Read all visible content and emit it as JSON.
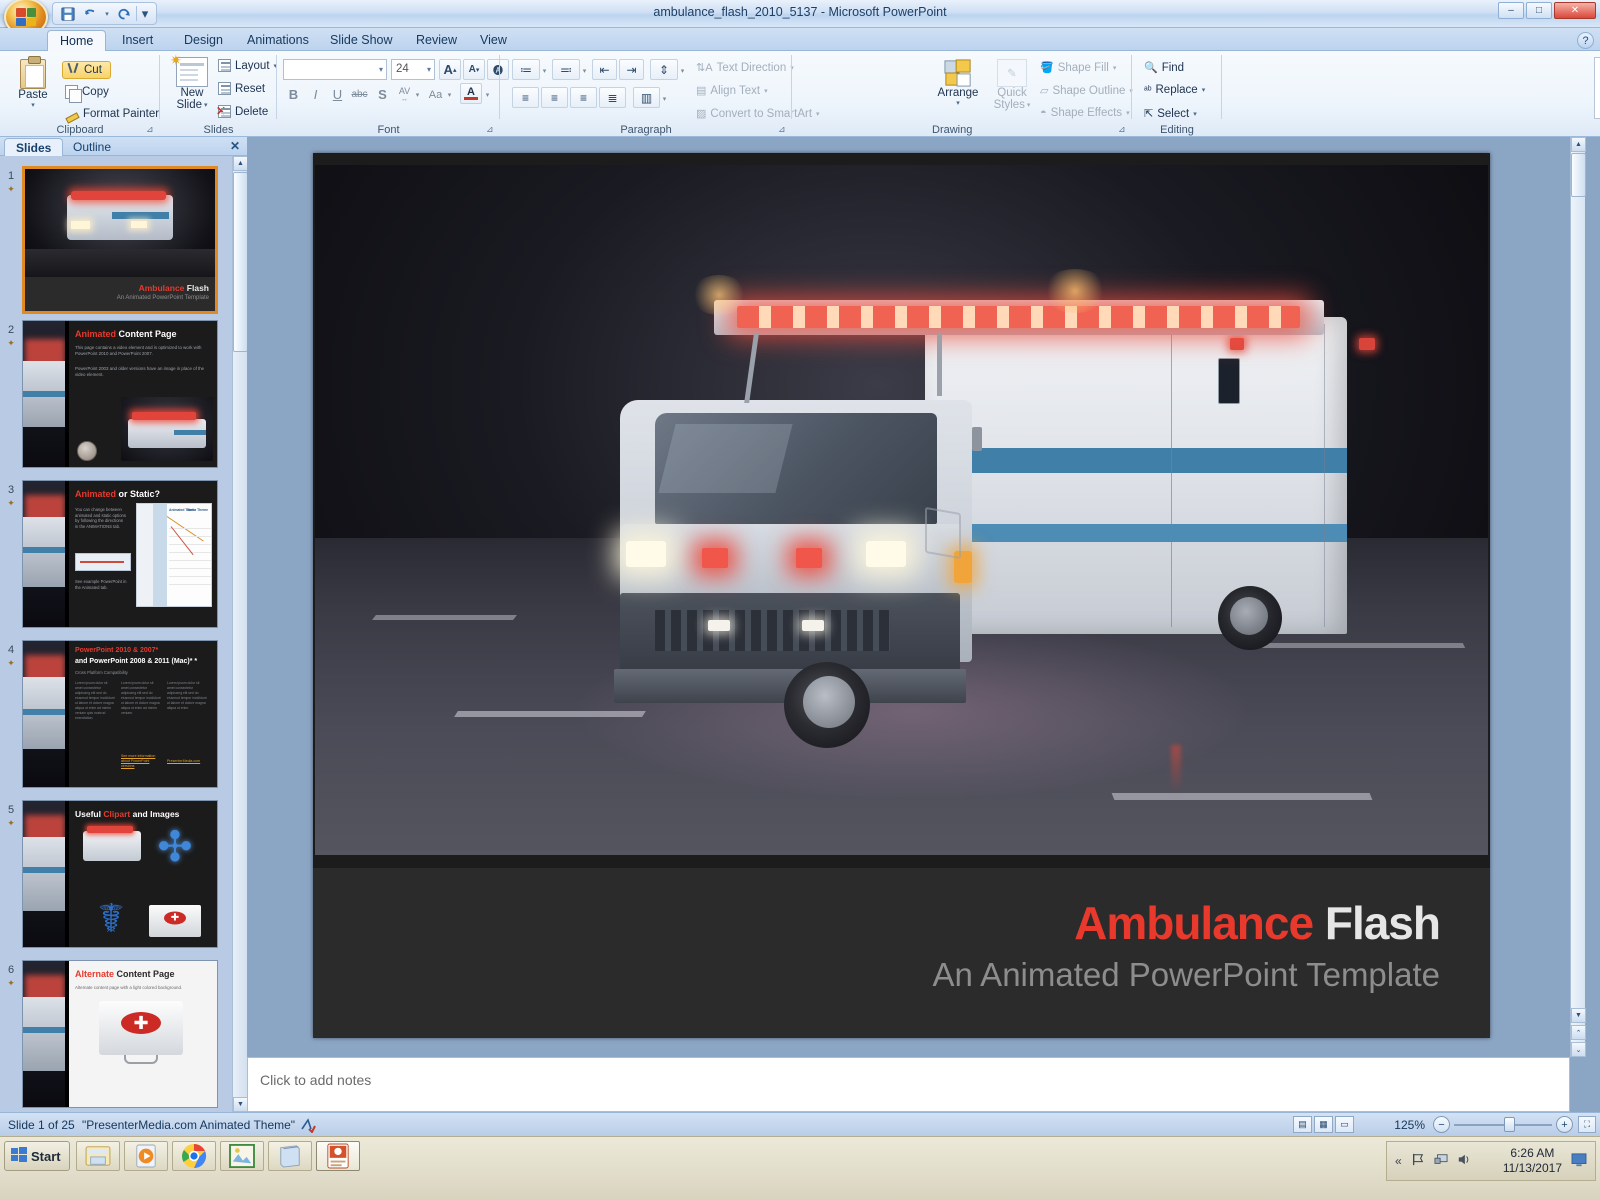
{
  "window": {
    "title": "ambulance_flash_2010_5137 - Microsoft PowerPoint",
    "minimize": "–",
    "maximize": "□",
    "close": "✕",
    "help": "?"
  },
  "quick_access": {
    "save": "💾",
    "undo": "↺",
    "redo": "↻",
    "customize": "▾"
  },
  "ribbon_tabs": [
    {
      "label": "Home",
      "active": true
    },
    {
      "label": "Insert",
      "active": false
    },
    {
      "label": "Design",
      "active": false
    },
    {
      "label": "Animations",
      "active": false
    },
    {
      "label": "Slide Show",
      "active": false
    },
    {
      "label": "Review",
      "active": false
    },
    {
      "label": "View",
      "active": false
    }
  ],
  "ribbon": {
    "clipboard": {
      "name": "Clipboard",
      "paste": "Paste",
      "cut": "Cut",
      "copy": "Copy",
      "format_painter": "Format Painter"
    },
    "slides": {
      "name": "Slides",
      "new_slide": "New\nSlide",
      "new_slide_l1": "New",
      "new_slide_l2": "Slide",
      "layout": "Layout",
      "reset": "Reset",
      "delete": "Delete"
    },
    "font": {
      "name": "Font",
      "font_family_value": "",
      "font_size_value": "24",
      "grow_font": "A",
      "shrink_font": "A",
      "clear_formatting": "Aa",
      "bold": "B",
      "italic": "I",
      "underline": "U",
      "strikethrough": "abc",
      "shadow": "S",
      "character_spacing": "AV",
      "change_case": "Aa",
      "font_color": "A"
    },
    "paragraph": {
      "name": "Paragraph",
      "text_direction": "Text Direction",
      "align_text": "Align Text",
      "convert_to_smartart": "Convert to SmartArt"
    },
    "drawing": {
      "name": "Drawing",
      "arrange": "Arrange",
      "quick_styles_l1": "Quick",
      "quick_styles_l2": "Styles",
      "shape_fill": "Shape Fill",
      "shape_outline": "Shape Outline",
      "shape_effects": "Shape Effects"
    },
    "editing": {
      "name": "Editing",
      "find": "Find",
      "replace": "Replace",
      "select": "Select"
    }
  },
  "left_pane": {
    "tabs": [
      {
        "label": "Slides",
        "active": true
      },
      {
        "label": "Outline",
        "active": false
      }
    ],
    "close": "✕",
    "slides": [
      {
        "number": "1",
        "selected": true,
        "kind": "title",
        "title_red": "Ambulance",
        "title_white": "Flash",
        "subtitle": "An Animated PowerPoint Template"
      },
      {
        "number": "2",
        "selected": false,
        "kind": "content",
        "title_red": "Animated",
        "title_white": "Content Page",
        "body1": "This page contains a video element and is optimized to work with PowerPoint 2010 and PowerPoint 2007.",
        "body2": "PowerPoint 2003 and older versions have an image in place of the video element."
      },
      {
        "number": "3",
        "selected": false,
        "kind": "static",
        "title_red": "Animated",
        "title_white": "or Static?",
        "body1": "You can change between animated and static options by following the directions in the ANIMATIONS tab.",
        "body2": "See example PowerPoint in the Animated tab."
      },
      {
        "number": "4",
        "selected": false,
        "kind": "compat",
        "title_red": "PowerPoint 2010 & 2007*",
        "title_white": "and PowerPoint 2008 & 2011 (Mac)* *",
        "subtitle": "Cross Platform Compatibility",
        "link1": "See more information about PowerPoint versions",
        "link2": "PresenterMedia.com"
      },
      {
        "number": "5",
        "selected": false,
        "kind": "clipart",
        "title_white1": "Useful ",
        "title_red": "Clipart",
        "title_white2": " and Images"
      },
      {
        "number": "6",
        "selected": false,
        "kind": "alternate",
        "title_red": "Alternate",
        "title_white": "Content Page",
        "body1": "Alternate content page with a light colored background."
      }
    ]
  },
  "slide": {
    "title_red": "Ambulance",
    "title_white": "Flash",
    "subtitle": "An Animated PowerPoint Template"
  },
  "notes": {
    "placeholder": "Click to add notes"
  },
  "status_bar": {
    "slide_count": "Slide 1 of 25",
    "theme": "\"PresenterMedia.com Animated Theme\"",
    "spelling_icon": "spell-check-icon",
    "view_normal": "▤",
    "view_sorter": "▦",
    "view_show": "▭",
    "zoom_level": "125%",
    "zoom_out": "−",
    "zoom_in": "+",
    "fit_slide": "⛶"
  },
  "taskbar": {
    "start": "Start",
    "items": [
      {
        "name": "explorer",
        "glyph": "🗂"
      },
      {
        "name": "media-player",
        "glyph": "▶"
      },
      {
        "name": "google-chrome",
        "glyph": "◉"
      },
      {
        "name": "image-viewer",
        "glyph": "🖼"
      },
      {
        "name": "notes-app",
        "glyph": "📘"
      },
      {
        "name": "powerpoint",
        "glyph": "P",
        "active": true
      }
    ],
    "tray": {
      "show_hidden": "«",
      "network": "⚑",
      "monitor": "🖥",
      "volume": "🔊",
      "time": "6:26 AM",
      "date": "11/13/2017"
    }
  },
  "colors": {
    "accent_red": "#e8392c",
    "slide_bg": "#2b2b2b",
    "ribbon_bg": "#eef5fc",
    "selection_orange": "#e08a24"
  }
}
